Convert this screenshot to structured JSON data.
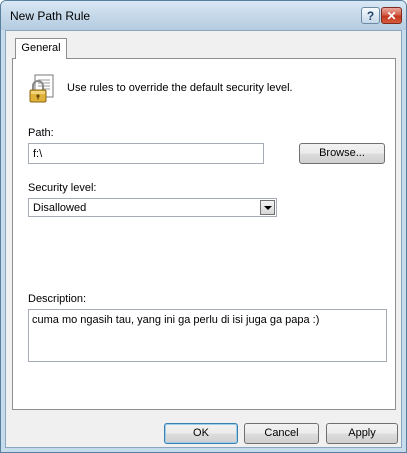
{
  "window": {
    "title": "New Path Rule",
    "help_label": "?",
    "close_label": "✕"
  },
  "tabs": [
    {
      "label": "General"
    }
  ],
  "intro": {
    "icon": "padlock-document-icon",
    "text": "Use rules to override the default security level."
  },
  "path": {
    "label": "Path:",
    "value": "f:\\",
    "browse_label": "Browse..."
  },
  "security_level": {
    "label": "Security level:",
    "selected": "Disallowed"
  },
  "description": {
    "label": "Description:",
    "value": "cuma mo ngasih tau, yang ini ga perlu di isi juga ga papa :)"
  },
  "footer": {
    "ok_label": "OK",
    "cancel_label": "Cancel",
    "apply_label": "Apply"
  },
  "colors": {
    "title_bar": "#c5d9ea",
    "close_button": "#c2371f",
    "dialog_background": "#f0f0f0"
  }
}
